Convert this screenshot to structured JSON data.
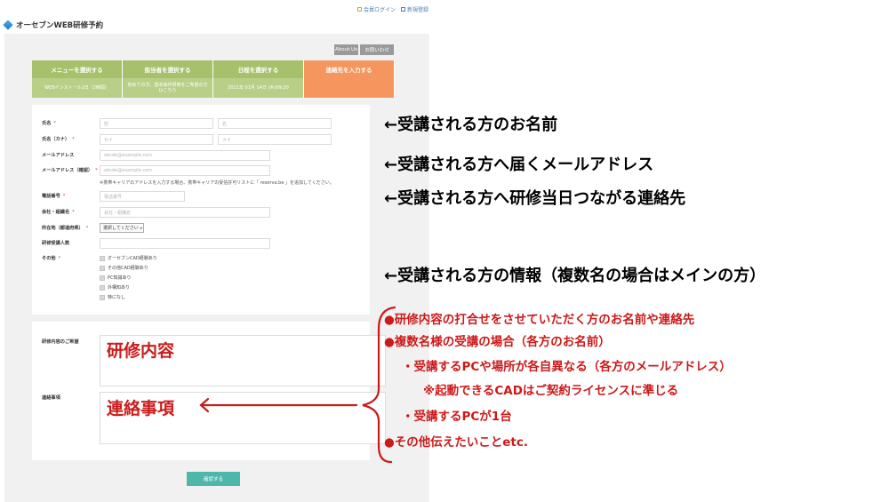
{
  "top_links": {
    "login": "会員ログイン",
    "register": "新規登録"
  },
  "site": {
    "title": "オーセブンWEB研修予約"
  },
  "buttons": {
    "about": "About Us",
    "contact": "お問いわせ",
    "confirm": "確認する"
  },
  "steps": [
    {
      "title": "メニューを選択する",
      "detail": "WEBインストール1日（2時間）",
      "state": "done"
    },
    {
      "title": "担当者を選択する",
      "detail": "初めての方、基本操作研修をご希望の方はこちら",
      "state": "done"
    },
    {
      "title": "日程を選択する",
      "detail": "2021年 01月 14日 (木)09:30",
      "state": "done"
    },
    {
      "title": "連絡先を入力する",
      "detail": "",
      "state": "current"
    }
  ],
  "form": {
    "name_label": "氏名",
    "name_last_ph": "姓",
    "name_first_ph": "名",
    "kana_label": "氏名（カナ）",
    "kana_last_ph": "セイ",
    "kana_first_ph": "メイ",
    "email_label": "メールアドレス",
    "email_ph": "abcde@example.com",
    "email_confirm_label": "メールアドレス（確認）",
    "email_confirm_ph": "abcde@example.com",
    "email_note": "※携帯キャリアのアドレスを入力する場合、携帯キャリアの受信許可リストに「 reserva.be 」を追加してください。",
    "phone_label": "電話番号",
    "phone_ph": "電話番号",
    "company_label": "会社・組織名",
    "company_ph": "会社・組織名",
    "pref_label": "所在地（都道府県）",
    "pref_value": "選択してください",
    "count_label": "研修受講人数",
    "other_label": "その他",
    "required_mark": "*",
    "checkboxes": [
      "オーセブンCAD経験あり",
      "その他CAD経験あり",
      "PC知識あり",
      "外構知あり",
      "特になし"
    ],
    "content_label": "研修内容のご希望",
    "contact_label": "連絡事項"
  },
  "annotations": {
    "name": "←受講される方のお名前",
    "email": "←受講される方へ届くメールアドレス",
    "phone": "←受講される方へ研修当日つながる連絡先",
    "info": "←受講される方の情報（複数名の場合はメインの方）",
    "content": "研修内容",
    "contact": "連絡事項",
    "notes": [
      "●研修内容の打合せをさせていただく方のお名前や連絡先",
      "●複数名様の受講の場合（各方のお名前）",
      "・受講するPCや場所が各自異なる（各方のメールアドレス）",
      "※起動できるCADはご契約ライセンスに準じる",
      "・受講するPCが1台",
      "●その他伝えたいことetc."
    ]
  },
  "colors": {
    "step_green": "#a6c06b",
    "step_orange": "#f4965e",
    "confirm": "#4fb7a9",
    "annotation_red": "#cc1a1a"
  }
}
